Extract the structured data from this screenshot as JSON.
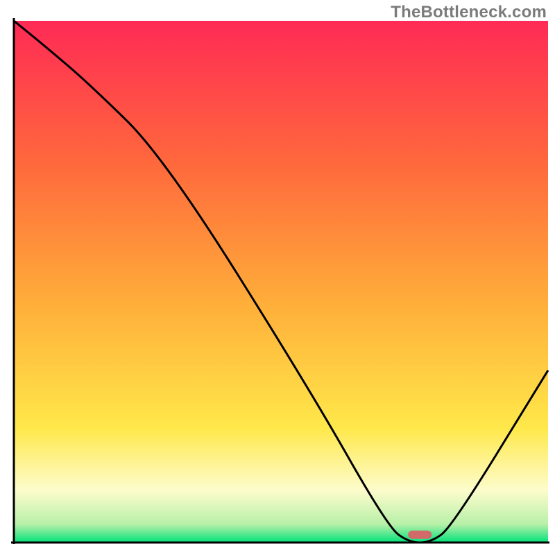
{
  "watermark": "TheBottleneck.com",
  "chart_data": {
    "type": "line",
    "title": "",
    "xlabel": "",
    "ylabel": "",
    "xlim": [
      0,
      100
    ],
    "ylim": [
      0,
      100
    ],
    "x": [
      0,
      6,
      14,
      28,
      55,
      70,
      74,
      78,
      82,
      100
    ],
    "values": [
      100,
      95,
      88,
      74,
      30,
      3,
      0,
      0,
      3,
      33
    ],
    "marker": {
      "x": 76,
      "y": 1.5
    },
    "gradient_stops": [
      {
        "offset": 0.0,
        "color": "#ff2a55"
      },
      {
        "offset": 0.28,
        "color": "#ff6a3c"
      },
      {
        "offset": 0.55,
        "color": "#ffb03a"
      },
      {
        "offset": 0.78,
        "color": "#ffe84a"
      },
      {
        "offset": 0.9,
        "color": "#fdfccc"
      },
      {
        "offset": 0.965,
        "color": "#b8f0a8"
      },
      {
        "offset": 1.0,
        "color": "#00e27a"
      }
    ],
    "series_color": "#000000",
    "marker_color": "#d36a6a",
    "axis_color": "#000000"
  }
}
